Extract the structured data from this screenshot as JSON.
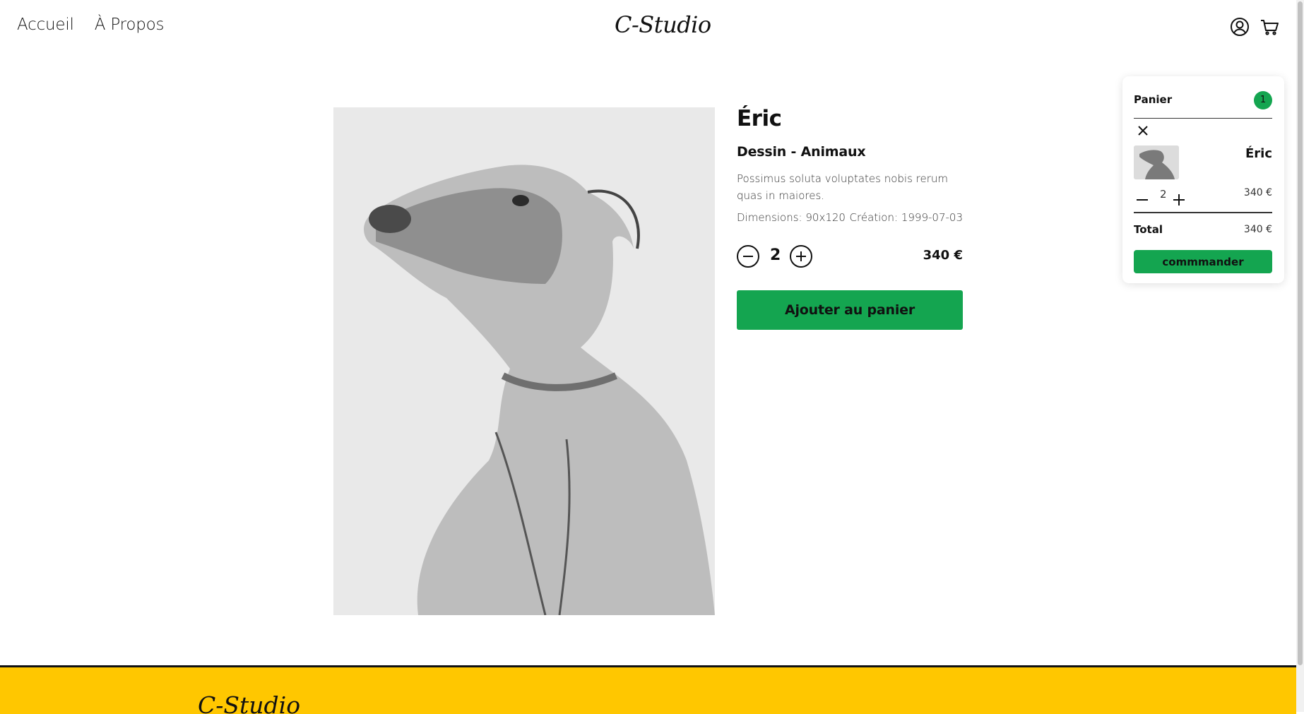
{
  "header": {
    "nav": [
      "Accueil",
      "À Propos"
    ],
    "logo": "C-Studio"
  },
  "product": {
    "title": "Éric",
    "subtitle": "Dessin - Animaux",
    "description": "Possimus soluta voluptates nobis rerum quas in maiores.",
    "dimensions": "Dimensions: 90x120",
    "creation": "Création: 1999-07-03",
    "quantity": "2",
    "price": "340 €",
    "add_button": "Ajouter au panier"
  },
  "cart": {
    "label": "Panier",
    "count": "1",
    "item": {
      "name": "Éric",
      "quantity": "2",
      "price": "340 €"
    },
    "total_label": "Total",
    "total_value": "340 €",
    "order_button": "commmander"
  },
  "footer": {
    "logo": "C-Studio"
  },
  "colors": {
    "accent": "#14a550",
    "footer": "#ffc700"
  },
  "icons": [
    "user-icon",
    "cart-icon",
    "close-icon",
    "minus-icon",
    "plus-icon"
  ]
}
